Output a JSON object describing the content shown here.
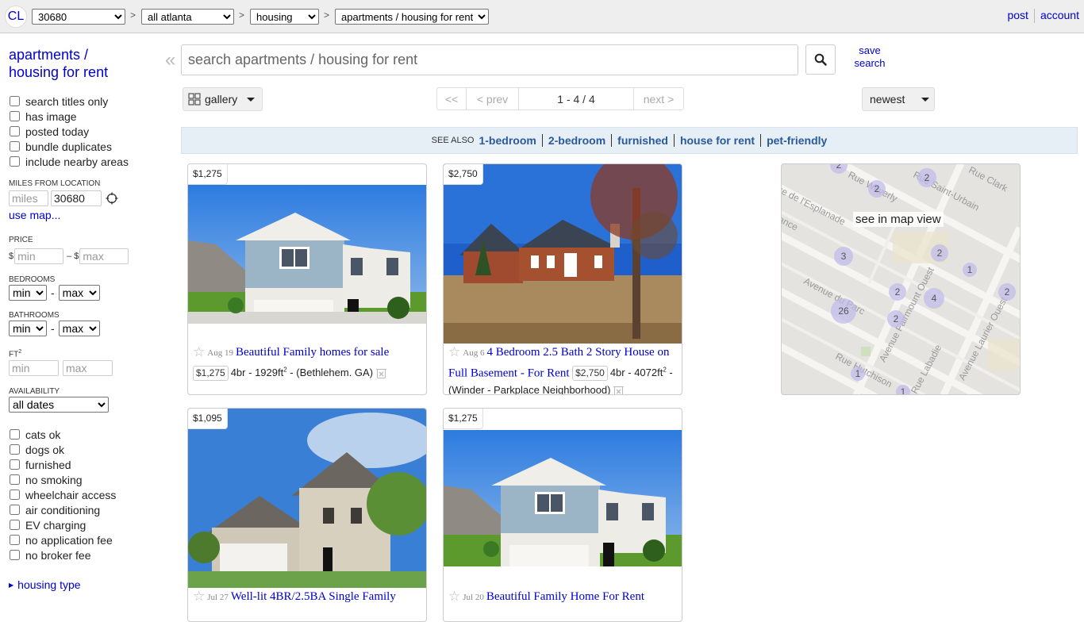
{
  "header": {
    "logo": "CL",
    "breadcrumbs": [
      {
        "value": "30680"
      },
      {
        "value": "all atlanta"
      },
      {
        "value": "housing"
      },
      {
        "value": "apartments / housing for rent"
      }
    ],
    "separator": ">",
    "links": {
      "post": "post",
      "account": "account"
    }
  },
  "sidebar": {
    "title": "apartments / housing for rent",
    "top_filters": [
      {
        "label": "search titles only",
        "checked": false
      },
      {
        "label": "has image",
        "checked": false
      },
      {
        "label": "posted today",
        "checked": false
      },
      {
        "label": "bundle duplicates",
        "checked": false
      },
      {
        "label": "include nearby areas",
        "checked": false
      }
    ],
    "miles_label": "MILES FROM LOCATION",
    "miles_placeholder": "miles",
    "zip_value": "30680",
    "use_map": "use map...",
    "price_label": "PRICE",
    "currency": "$",
    "dash": "–",
    "min_placeholder": "min",
    "max_placeholder": "max",
    "bedrooms_label": "BEDROOMS",
    "bathrooms_label": "BATHROOMS",
    "select_min": "min",
    "select_max": "max",
    "range_dash": "-",
    "sqft_label": "FT",
    "sqft_sup": "2",
    "availability_label": "AVAILABILITY",
    "availability_value": "all dates",
    "amenities": [
      {
        "label": "cats ok",
        "checked": false
      },
      {
        "label": "dogs ok",
        "checked": false
      },
      {
        "label": "furnished",
        "checked": false
      },
      {
        "label": "no smoking",
        "checked": false
      },
      {
        "label": "wheelchair access",
        "checked": false
      },
      {
        "label": "air conditioning",
        "checked": false
      },
      {
        "label": "EV charging",
        "checked": false
      },
      {
        "label": "no application fee",
        "checked": false
      },
      {
        "label": "no broker fee",
        "checked": false
      }
    ],
    "housing_type": "housing type"
  },
  "search": {
    "placeholder": "search apartments / housing for rent",
    "save_line1": "save",
    "save_line2": "search"
  },
  "toolbar": {
    "view_mode": "gallery",
    "pager": {
      "first": "<<",
      "prev": "< prev",
      "range": "1 - 4 / 4",
      "next": "next >"
    },
    "sort": "newest"
  },
  "see_also": {
    "label": "SEE ALSO",
    "links": [
      "1-bedroom",
      "2-bedroom",
      "furnished",
      "house for rent",
      "pet-friendly"
    ]
  },
  "listings": [
    {
      "price": "$1,275",
      "date": "Aug 19",
      "title": "Beautiful Family homes for sale",
      "bedrooms": "4br",
      "sqft": "1929",
      "location": "(Bethlehem. GA)"
    },
    {
      "price": "$2,750",
      "date": "Aug 6",
      "title": "4 Bedroom 2.5 Bath 2 Story House on Full Basement - For Rent",
      "bedrooms": "4br",
      "sqft": "4072",
      "location": "(Winder - Parkplace Neighborhood)"
    },
    {
      "price": "$1,095",
      "date": "Jul 27",
      "title": "Well-lit 4BR/2.5BA Single Family"
    },
    {
      "price": "$1,275",
      "date": "Jul 20",
      "title": "Beautiful Family Home For Rent"
    }
  ],
  "map": {
    "label": "see in map view",
    "streets": [
      "Rue Waverly",
      "Rue Saint-Urbain",
      "ue de l'Esplanade",
      "Rue Clark",
      "ance",
      "Avenue du Parc",
      "Avenue Fairmount Ouest",
      "Avenue Laurier Ouest",
      "Rue Hutchison",
      "Rue Labadie"
    ],
    "clusters": [
      "2",
      "2",
      "3",
      "2",
      "1",
      "2",
      "4",
      "2",
      "26",
      "2",
      "1",
      "1"
    ]
  }
}
